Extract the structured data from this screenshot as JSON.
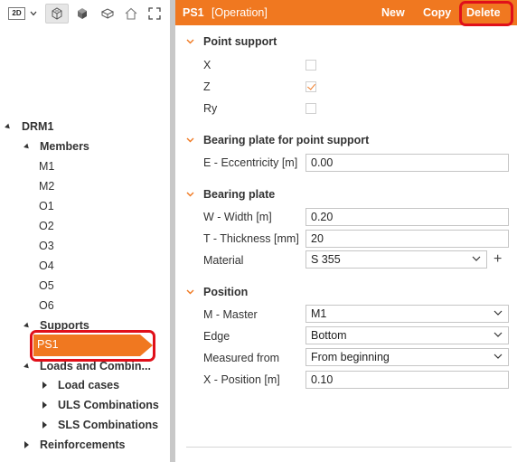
{
  "toolbar": {
    "view_mode": "2D",
    "icons": [
      "wireframe-view-icon",
      "solid-view-icon",
      "view-plane-icon",
      "home-icon",
      "fit-view-icon"
    ]
  },
  "tree": {
    "root": "DRM1",
    "members_label": "Members",
    "members": [
      "M1",
      "M2",
      "O1",
      "O2",
      "O3",
      "O4",
      "O5",
      "O6"
    ],
    "supports_label": "Supports",
    "selected_support": "PS1",
    "loads_label": "Loads and Combin...",
    "load_cases": "Load cases",
    "uls": "ULS Combinations",
    "sls": "SLS Combinations",
    "reinforcements": "Reinforcements"
  },
  "panel": {
    "title": "PS1",
    "subtitle": "[Operation]",
    "actions": {
      "new": "New",
      "copy": "Copy",
      "delete": "Delete"
    }
  },
  "point_support": {
    "title": "Point support",
    "x_label": "X",
    "x_checked": false,
    "z_label": "Z",
    "z_checked": true,
    "ry_label": "Ry",
    "ry_checked": false
  },
  "bearing_plate_point": {
    "title": "Bearing plate for point support",
    "ecc_label": "E - Eccentricity [m]",
    "ecc_value": "0.00"
  },
  "bearing_plate": {
    "title": "Bearing plate",
    "width_label": "W - Width [m]",
    "width_value": "0.20",
    "thickness_label": "T - Thickness [mm]",
    "thickness_value": "20",
    "material_label": "Material",
    "material_value": "S 355"
  },
  "position": {
    "title": "Position",
    "master_label": "M - Master",
    "master_value": "M1",
    "edge_label": "Edge",
    "edge_value": "Bottom",
    "measured_label": "Measured from",
    "measured_value": "From beginning",
    "xpos_label": "X - Position [m]",
    "xpos_value": "0.10"
  },
  "colors": {
    "accent": "#f07820",
    "highlight": "#e0101a"
  }
}
